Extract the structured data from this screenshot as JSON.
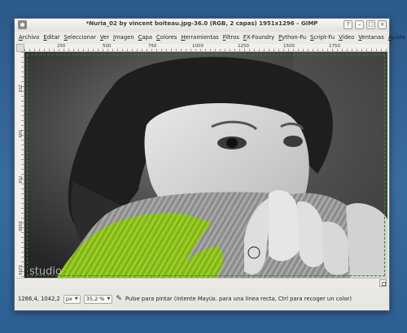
{
  "window": {
    "title": "*Nuria_02 by vincent boiteau.jpg-36.0 (RGB, 2 capas) 1951x1296 – GIMP",
    "controls": {
      "help": "?",
      "minimize": "–",
      "maximize": "□",
      "close": "×"
    }
  },
  "menu": [
    "Archivo",
    "Editar",
    "Seleccionar",
    "Ver",
    "Imagen",
    "Capa",
    "Colores",
    "Herramientas",
    "Filtros",
    "FX-Foundry",
    "Python-Fu",
    "Script-Fu",
    "Vídeo",
    "Ventanas",
    "Ayuda"
  ],
  "ruler": {
    "horizontal": [
      "250",
      "500",
      "750",
      "1000",
      "1250",
      "1500",
      "1750"
    ],
    "vertical": [
      "250",
      "500",
      "750",
      "1000",
      "1250"
    ]
  },
  "image": {
    "watermark": "studio",
    "subject": "black-and-white portrait of woman with partially green-tinted sweater"
  },
  "status": {
    "coords": "1286,4, 1042,2",
    "unit": "px",
    "zoom": "35,2 %",
    "hint": "Pulse para pintar (intente Mayús. para una línea recta, Ctrl para recoger un color)"
  },
  "colors": {
    "selection": "#2c8a2c",
    "tint": "#8cc21a",
    "desktop": "#2b5a8a"
  },
  "icons": {
    "app": "gimp-icon",
    "paint": "brush-icon"
  }
}
